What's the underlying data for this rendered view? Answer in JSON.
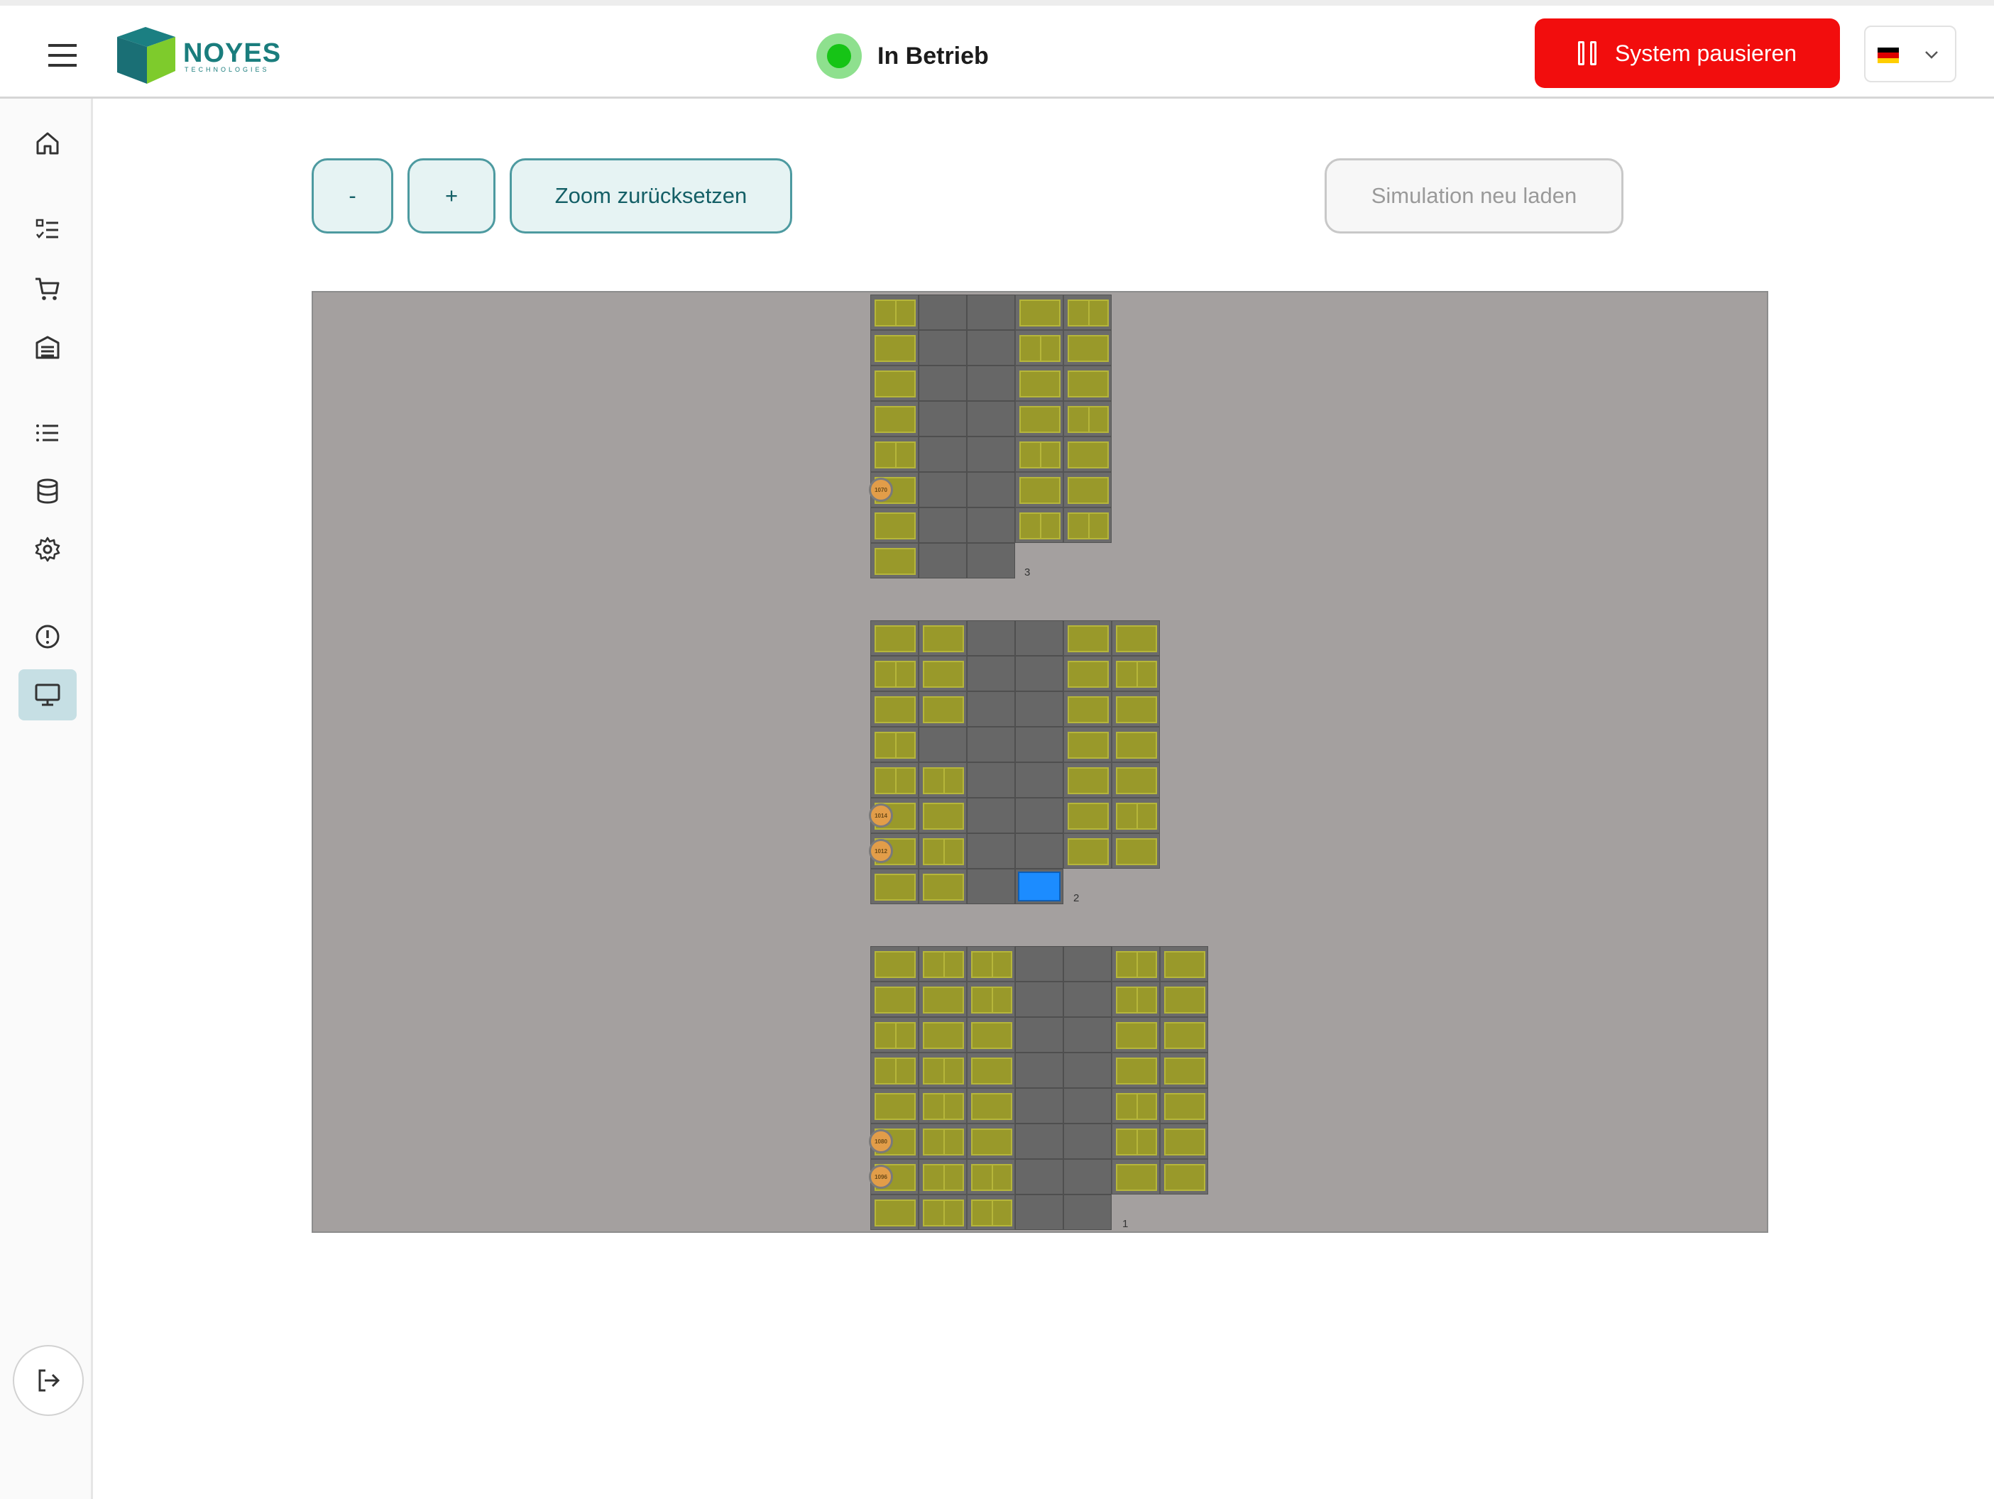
{
  "header": {
    "brand": "NOYES",
    "brand_sub": "TECHNOLOGIES",
    "status_text": "In Betrieb",
    "pause_label": "System pausieren",
    "language": "de"
  },
  "sidebar": {
    "items": [
      {
        "name": "home",
        "icon": "home-icon"
      },
      {
        "name": "orders",
        "icon": "checklist-icon"
      },
      {
        "name": "cart",
        "icon": "cart-icon"
      },
      {
        "name": "storage",
        "icon": "warehouse-icon"
      },
      {
        "name": "list",
        "icon": "list-icon"
      },
      {
        "name": "database",
        "icon": "database-icon"
      },
      {
        "name": "settings",
        "icon": "gear-icon"
      },
      {
        "name": "alerts",
        "icon": "alert-circle-icon"
      },
      {
        "name": "monitor",
        "icon": "monitor-icon",
        "active": true
      }
    ],
    "logout_icon": "logout-icon"
  },
  "toolbar": {
    "zoom_out_label": "-",
    "zoom_in_label": "+",
    "zoom_reset_label": "Zoom zurücksetzen",
    "reload_label": "Simulation neu laden"
  },
  "simulation": {
    "colors": {
      "container": "#99992a",
      "aisle": "#676767",
      "floor": "#a4a09f",
      "highlight": "#1c8cff",
      "robot": "#e29d49"
    },
    "racks": [
      {
        "label": "3"
      },
      {
        "label": "2"
      },
      {
        "label": "1"
      }
    ],
    "robots": [
      "1070",
      "1014",
      "1012",
      "1080",
      "1096"
    ]
  }
}
